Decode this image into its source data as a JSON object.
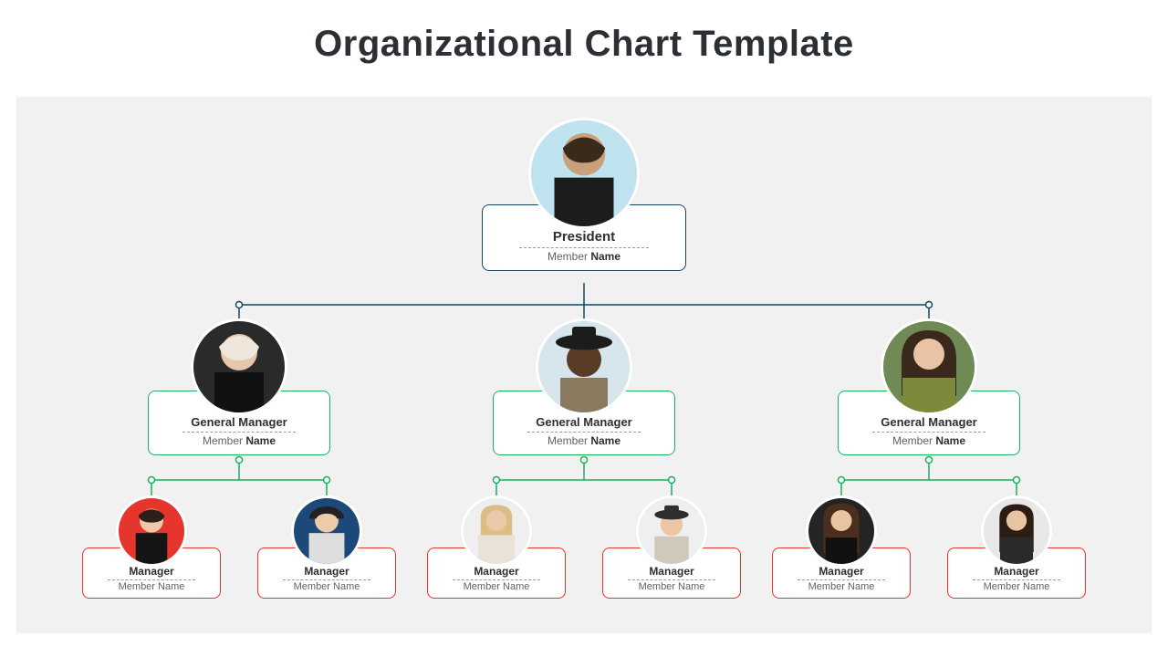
{
  "title": "Organizational Chart Template",
  "labels": {
    "member_prefix": "Member ",
    "member_bold": "Name"
  },
  "colors": {
    "tier1": "#14455f",
    "tier2": "#17b05e",
    "tier3": "#e6352c"
  },
  "org": {
    "root": {
      "role": "President",
      "member": "Member Name"
    },
    "branches": [
      {
        "role": "General Manager",
        "member": "Member Name",
        "reports": [
          {
            "role": "Manager",
            "member": "Member Name"
          },
          {
            "role": "Manager",
            "member": "Member Name"
          }
        ]
      },
      {
        "role": "General Manager",
        "member": "Member Name",
        "reports": [
          {
            "role": "Manager",
            "member": "Member Name"
          },
          {
            "role": "Manager",
            "member": "Member Name"
          }
        ]
      },
      {
        "role": "General Manager",
        "member": "Member Name",
        "reports": [
          {
            "role": "Manager",
            "member": "Member Name"
          },
          {
            "role": "Manager",
            "member": "Member Name"
          }
        ]
      }
    ]
  }
}
